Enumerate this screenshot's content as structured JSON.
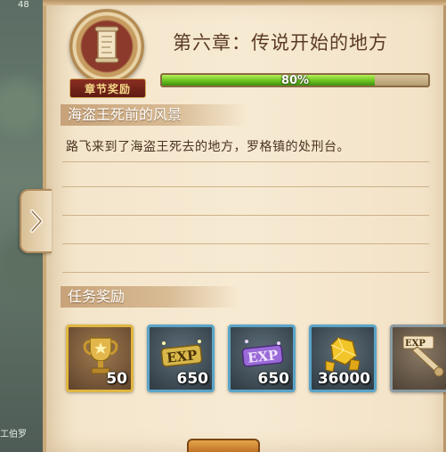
{
  "hud": {
    "top_number": "48",
    "bottom_text": "工伯罗"
  },
  "chapter": {
    "title": "第六章：传说开始的地方",
    "badge_label": "章节奖励",
    "progress_text": "80%",
    "progress_value": 0.8
  },
  "quest": {
    "title": "海盗王死前的风景",
    "description": "路飞来到了海盗王死去的地方，罗格镇的处刑台。"
  },
  "rewards": {
    "title": "任务奖励",
    "items": [
      {
        "icon": "trophy-icon",
        "count": "50",
        "frame": "gold"
      },
      {
        "icon": "exp-gold-icon",
        "count": "650",
        "frame": "blue"
      },
      {
        "icon": "exp-purple-icon",
        "count": "650",
        "frame": "blue"
      },
      {
        "icon": "gold-gem-icon",
        "count": "36000",
        "frame": "blue"
      },
      {
        "icon": "exp-scroll-icon",
        "count": "",
        "frame": "gray"
      }
    ]
  },
  "colors": {
    "title_text": "#5a3a26",
    "progress_fill": "#6bc31f",
    "badge_ribbon": "#8a2f22",
    "frame_gold": "#e0b640",
    "frame_blue": "#5aa4c8"
  }
}
